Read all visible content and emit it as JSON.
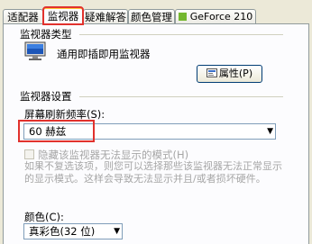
{
  "tabs": [
    {
      "label": "适配器",
      "active": false
    },
    {
      "label": "监视器",
      "active": true
    },
    {
      "label": "疑难解答",
      "active": false
    },
    {
      "label": "颜色管理",
      "active": false
    },
    {
      "label": "GeForce 210",
      "active": false
    }
  ],
  "monitor_type": {
    "group_label": "监视器类型",
    "monitor_name": "通用即插即用监视器",
    "properties_button": "属性(P)"
  },
  "monitor_settings": {
    "group_label": "监视器设置",
    "refresh_label": "屏幕刷新频率(S):",
    "refresh_value": "60 赫兹",
    "hide_modes_label": "隐藏该监视器无法显示的模式(H)",
    "hide_modes_checked": false,
    "description": "如果不复选该项，则您可以选择那些该监视器无法正常显示的显示模式。这样会导致无法显示并且/或者损坏硬件。"
  },
  "color": {
    "label": "颜色(C):",
    "value": "真彩色(32 位)"
  },
  "colors": {
    "highlight": "#e1322d",
    "active_tab_top": "#ffc83c",
    "nvidia_green": "#74b72e"
  },
  "icons": [
    "monitor-icon",
    "properties-icon",
    "nvidia-icon",
    "dropdown-arrow-icon"
  ]
}
